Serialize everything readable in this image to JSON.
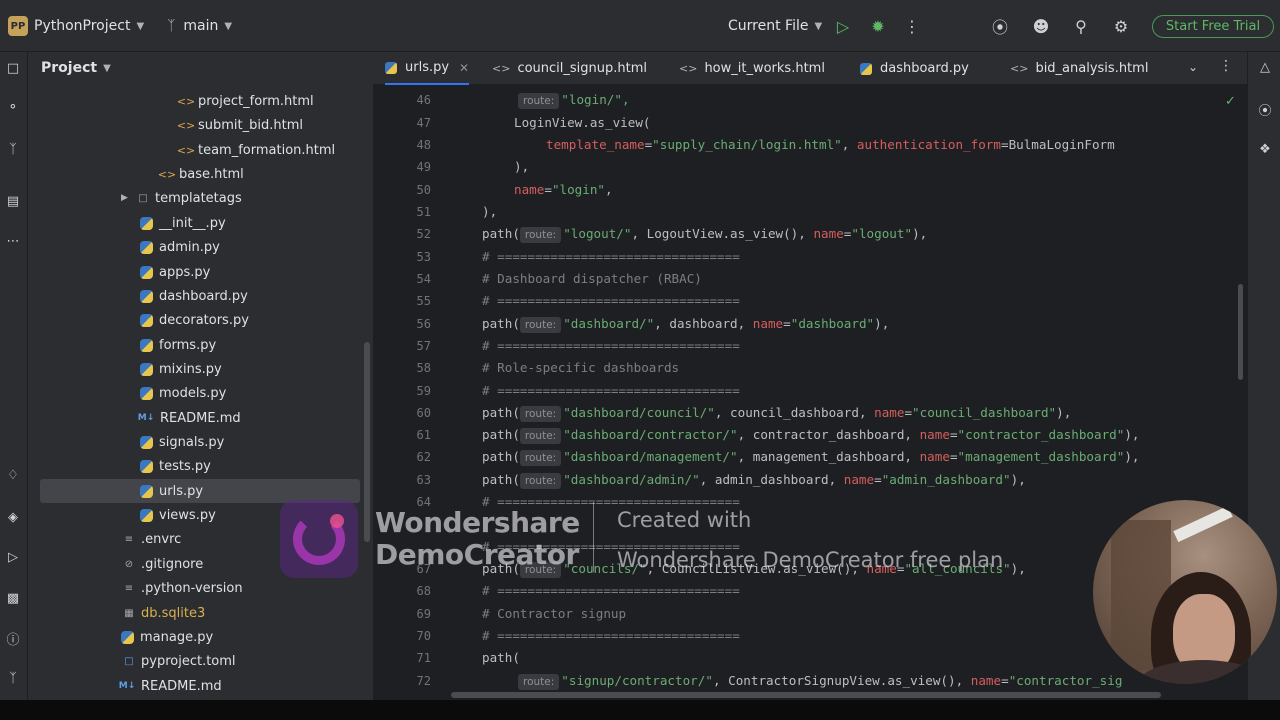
{
  "titlebar": {
    "project_badge": "PP",
    "project_name": "PythonProject",
    "branch_name": "main",
    "run_config": "Current File",
    "trial_button": "Start Free Trial"
  },
  "project_panel": {
    "title": "Project",
    "items": [
      {
        "label": "project_form.html",
        "type": "html"
      },
      {
        "label": "submit_bid.html",
        "type": "html"
      },
      {
        "label": "team_formation.html",
        "type": "html"
      },
      {
        "label": "base.html",
        "type": "html"
      },
      {
        "label": "templatetags",
        "type": "folder"
      },
      {
        "label": "__init__.py",
        "type": "py"
      },
      {
        "label": "admin.py",
        "type": "py"
      },
      {
        "label": "apps.py",
        "type": "py"
      },
      {
        "label": "dashboard.py",
        "type": "py"
      },
      {
        "label": "decorators.py",
        "type": "py"
      },
      {
        "label": "forms.py",
        "type": "py"
      },
      {
        "label": "mixins.py",
        "type": "py"
      },
      {
        "label": "models.py",
        "type": "py"
      },
      {
        "label": "README.md",
        "type": "md"
      },
      {
        "label": "signals.py",
        "type": "py"
      },
      {
        "label": "tests.py",
        "type": "py"
      },
      {
        "label": "urls.py",
        "type": "py"
      },
      {
        "label": "views.py",
        "type": "py"
      },
      {
        "label": ".envrc",
        "type": "file"
      },
      {
        "label": ".gitignore",
        "type": "ignore"
      },
      {
        "label": ".python-version",
        "type": "file"
      },
      {
        "label": "db.sqlite3",
        "type": "db"
      },
      {
        "label": "manage.py",
        "type": "py"
      },
      {
        "label": "pyproject.toml",
        "type": "toml"
      },
      {
        "label": "README.md",
        "type": "md"
      }
    ]
  },
  "tabs": [
    {
      "label": "urls.py",
      "active": true
    },
    {
      "label": "council_signup.html",
      "active": false
    },
    {
      "label": "how_it_works.html",
      "active": false
    },
    {
      "label": "dashboard.py",
      "active": false
    },
    {
      "label": "bid_analysis.html",
      "active": false
    }
  ],
  "editor": {
    "line_numbers": [
      "46",
      "47",
      "48",
      "49",
      "50",
      "51",
      "52",
      "53",
      "54",
      "55",
      "56",
      "57",
      "58",
      "59",
      "60",
      "61",
      "62",
      "63",
      "64",
      "",
      "67",
      "68",
      "69",
      "70",
      "71",
      "72"
    ],
    "hint_route": "route:",
    "code": {
      "l46_str": "\"login/\",",
      "l47_text": "LoginView.as_view(",
      "l48_p1": "template_name",
      "l48_s1": "\"supply_chain/login.html\"",
      "l48_p2": "authentication_form",
      "l48_v2": "BulmaLoginForm",
      "l49_text": "),",
      "l50_p": "name",
      "l50_s": "\"login\"",
      "l51_text": "),",
      "l52_s1": "\"logout/\"",
      "l52_mid": "LogoutView.as_view()",
      "l52_s2": "\"logout\"",
      "sep": "# ================================",
      "l54_cmt": "# Dashboard dispatcher (RBAC)",
      "l56_s1": "\"dashboard/\"",
      "l56_mid": "dashboard",
      "l56_s2": "\"dashboard\"",
      "l58_cmt": "# Role-specific dashboards",
      "l60_s1": "\"dashboard/council/\"",
      "l60_mid": "council_dashboard",
      "l60_s2": "\"council_dashboard\"",
      "l61_s1": "\"dashboard/contractor/\"",
      "l61_mid": "contractor_dashboard",
      "l61_s2": "\"contractor_dashboard\"",
      "l62_s1": "\"dashboard/management/\"",
      "l62_mid": "management_dashboard",
      "l62_s2": "\"management_dashboard\"",
      "l63_s1": "\"dashboard/admin/\"",
      "l63_mid": "admin_dashboard",
      "l63_s2": "\"admin_dashboard\"",
      "l67_s1": "\"councils/\"",
      "l67_mid": "CouncilListView.as_view()",
      "l67_s2": "\"all_councils\"",
      "l69_cmt": "# Contractor signup",
      "path_fn": "path(",
      "name_kw": "name",
      "l72_s1": "\"signup/contractor/\"",
      "l72_mid": "ContractorSignupView.as_view()",
      "l72_s2": "\"contractor_sig"
    }
  },
  "watermark": {
    "brand_line1": "Wondershare",
    "brand_line2": "DemoCreator",
    "note_line1": "Created with",
    "note_line2": "Wondershare DemoCreator free plan"
  }
}
